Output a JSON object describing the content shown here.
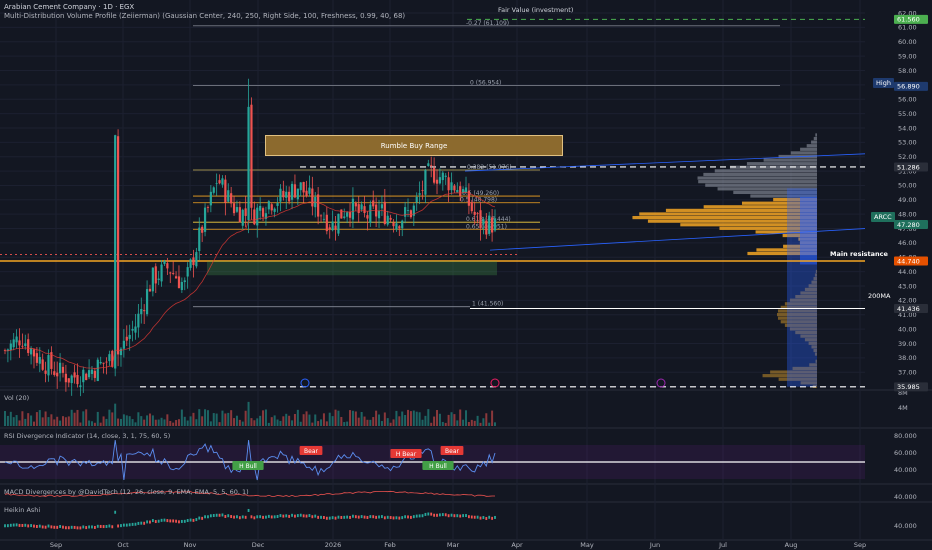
{
  "header": {
    "title": "Arabian Cement Company · 1D · EGX",
    "subtitle": "Multi-Distribution Volume Profile (Zeiierman) (Gaussian Center, 240, 250, Right Side, 100, Freshness, 0.99, 40, 68)"
  },
  "colors": {
    "background": "#131722",
    "up": "#26a69a",
    "down": "#ef5350",
    "rumble": "#8c6a2e",
    "main_resistance": "#f5a623",
    "fair_value": "#4caf50",
    "profile_blue": "#2962ff",
    "profile_orange": "#f5a623"
  },
  "annotations": {
    "fair_value": "Fair Value (investment)",
    "rumble_box": "Rumble Buy Range",
    "main_resistance": "Main resistance",
    "ma200": "200MA",
    "high_label": "High",
    "ticker_label": "ARCC"
  },
  "fib_levels": [
    {
      "text": "-0.27 (61.109)",
      "value": 61.109
    },
    {
      "text": "0 (56.954)",
      "value": 56.954
    },
    {
      "text": "0.382 (51.076)",
      "value": 51.076
    },
    {
      "text": "0.5 (49.260)",
      "value": 49.26
    },
    {
      "text": "0.5 (48.798)",
      "value": 48.798
    },
    {
      "text": "0.618 (47.444)",
      "value": 47.444
    },
    {
      "text": "0.65 (46.951)",
      "value": 46.951
    },
    {
      "text": "1 (41.560)",
      "value": 41.56
    }
  ],
  "price_tags": [
    {
      "text": "61.560",
      "value": 61.56,
      "color": "#4caf50"
    },
    {
      "text": "56.890",
      "value": 56.89,
      "color": "#1e3a6e"
    },
    {
      "text": "51.286",
      "value": 51.286,
      "color": "#2a2e39"
    },
    {
      "text": "47.280",
      "value": 47.28,
      "color": "#1f6f5c"
    },
    {
      "text": "44.740",
      "value": 44.74,
      "color": "#e65100"
    },
    {
      "text": "41.436",
      "value": 41.436,
      "color": "#2a2e39"
    },
    {
      "text": "35.985",
      "value": 35.985,
      "color": "#2a2e39"
    }
  ],
  "panes": {
    "vol": "Vol (20)",
    "rsi": "RSI Divergence Indicator (14, close, 3, 1, 75, 60, 5)",
    "macd": "MACD Divergences by @DavidTech (12, 26, close, 9, EMA, EMA, 5, 5, 60, 1)",
    "ha": "Heikin Ashi"
  },
  "rsi_labels": [
    {
      "text": "H Bull",
      "kind": "bull"
    },
    {
      "text": "Bear",
      "kind": "bear"
    },
    {
      "text": "H Bear",
      "kind": "bear"
    },
    {
      "text": "H Bull",
      "kind": "bull"
    },
    {
      "text": "Bear",
      "kind": "bear"
    }
  ],
  "chart_data": {
    "type": "candlestick",
    "x_labels": [
      "Sep",
      "Oct",
      "Nov",
      "Dec",
      "2026",
      "Feb",
      "Mar",
      "Apr",
      "May",
      "Jun",
      "Jul",
      "Aug",
      "Sep"
    ],
    "y_ticks": [
      36,
      37,
      38,
      39,
      40,
      41,
      42,
      43,
      44,
      45,
      46,
      47,
      48,
      49,
      50,
      51,
      52,
      53,
      54,
      55,
      56,
      57,
      58,
      59,
      60,
      61,
      62
    ],
    "ylim": [
      35.5,
      62.3
    ],
    "vol_ticks": [
      "8M",
      "4M"
    ],
    "rsi_ticks": [
      "80.000",
      "60.000",
      "40.000"
    ],
    "macd_ticks": [
      "40.000"
    ],
    "ha_ticks": [
      "40.000"
    ],
    "close_path": [
      [
        "Aug 25",
        38.5
      ],
      [
        "Sep 1",
        39.5
      ],
      [
        "Sep 8",
        38.0
      ],
      [
        "Sep 15",
        37.2
      ],
      [
        "Sep 22",
        36.6
      ],
      [
        "Sep 29",
        37.0
      ],
      [
        "Oct 6",
        37.6
      ],
      [
        "Oct 13",
        38.4
      ],
      [
        "Oct 20",
        40.3
      ],
      [
        "Oct 27",
        43.5
      ],
      [
        "Nov 3",
        44.3
      ],
      [
        "Nov 10",
        43.0
      ],
      [
        "Nov 17",
        46.8
      ],
      [
        "Nov 24",
        50.5
      ],
      [
        "Dec 1",
        48.5
      ],
      [
        "Dec 8",
        47.8
      ],
      [
        "Dec 15",
        48.8
      ],
      [
        "Dec 22",
        49.2
      ],
      [
        "Dec 29",
        50.0
      ],
      [
        "Jan 5",
        48.6
      ],
      [
        "Jan 12",
        47.2
      ],
      [
        "Jan 19",
        48.6
      ],
      [
        "Jan 26",
        47.8
      ],
      [
        "Feb 2",
        48.2
      ],
      [
        "Feb 9",
        47.6
      ],
      [
        "Feb 16",
        48.3
      ],
      [
        "Feb 23",
        51.0
      ],
      [
        "Mar 2",
        50.4
      ],
      [
        "Mar 9",
        49.6
      ],
      [
        "Mar 16",
        47.4
      ],
      [
        "Mar 20",
        47.28
      ]
    ],
    "high": 56.89,
    "last": 47.28
  }
}
